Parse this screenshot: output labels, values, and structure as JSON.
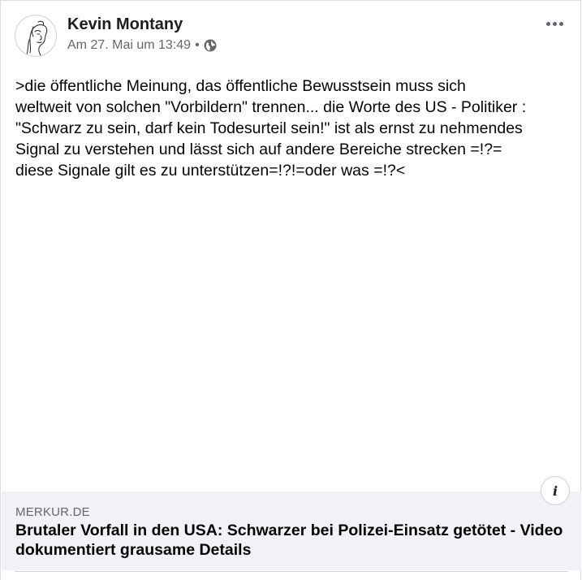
{
  "post": {
    "author": "Kevin Montany",
    "timestamp": "Am 27. Mai um 13:49",
    "separator": "•",
    "audience_icon": "globe-icon",
    "more_icon": "more-options-icon",
    "text": ">die öffentliche Meinung, das öffentliche Bewusstsein muss sich\nweltweit von solchen \"Vorbildern\" trennen... die Worte des US - Politiker :\n\"Schwarz zu sein, darf kein Todesurteil sein!\" ist als ernst zu nehmendes\nSignal zu verstehen und lässt sich auf andere Bereiche strecken =!?=\ndiese Signale gilt es zu unterstützen=!?!=oder was =!?<"
  },
  "link_preview": {
    "domain": "MERKUR.DE",
    "title": "Brutaler Vorfall in den USA: Schwarzer bei Polizei-Einsatz getötet - Video dokumentiert grausame Details",
    "info_icon": "info-icon",
    "info_glyph": "i"
  },
  "colors": {
    "text": "#050505",
    "secondary": "#65676b",
    "preview_bg": "#f0f2f5",
    "border": "#dadde1"
  }
}
